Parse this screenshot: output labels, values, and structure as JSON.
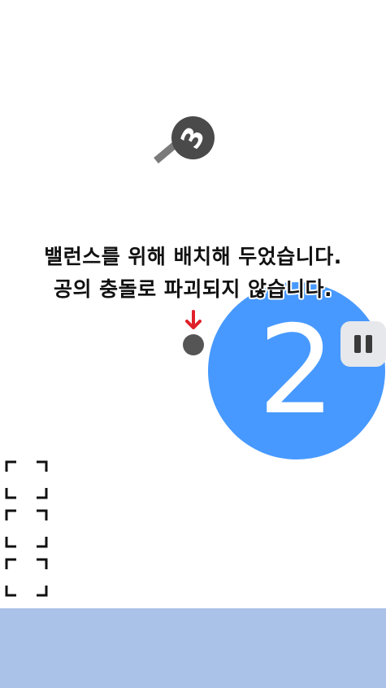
{
  "pin": {
    "number": "3"
  },
  "hint": {
    "line1": "밸런스를 위해 배치해 두었습니다.",
    "line2": "공의 충돌로 파괴되지 않습니다."
  },
  "big_ball": {
    "number": "2",
    "color": "#4799ff"
  },
  "small_ball": {
    "color": "#555555"
  },
  "arrow": {
    "icon": "down-arrow-icon",
    "color": "#e0202a"
  },
  "pause_button": {
    "icon": "pause-icon"
  },
  "slots": {
    "count": 3
  },
  "ground": {
    "color": "#aac1e8"
  }
}
